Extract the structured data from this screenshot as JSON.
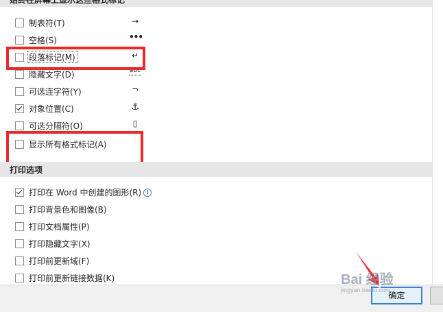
{
  "display_section": {
    "header": "始终在屏幕上显示这些格式标记",
    "items": [
      {
        "label": "制表符(T)",
        "checked": false,
        "symbol": "→",
        "symbol_icon": "tab-arrow-icon"
      },
      {
        "label": "空格(S)",
        "checked": false,
        "symbol": "•••",
        "symbol_icon": "space-dots-icon"
      },
      {
        "label": "段落标记(M)",
        "checked": false,
        "symbol": "↵",
        "symbol_icon": "paragraph-mark-icon"
      },
      {
        "label": "隐藏文字(D)",
        "checked": false,
        "symbol": "abc",
        "symbol_icon": "hidden-text-icon"
      },
      {
        "label": "可选连字符(Y)",
        "checked": false,
        "symbol": "¬",
        "symbol_icon": "optional-hyphen-icon"
      },
      {
        "label": "对象位置(C)",
        "checked": true,
        "symbol": "⚓",
        "symbol_icon": "anchor-icon"
      },
      {
        "label": "可选分隔符(O)",
        "checked": false,
        "symbol": "▯",
        "symbol_icon": "optional-break-icon"
      },
      {
        "label": "显示所有格式标记(A)",
        "checked": false,
        "symbol": "",
        "symbol_icon": ""
      }
    ]
  },
  "print_section": {
    "header": "打印选项",
    "items": [
      {
        "label": "打印在 Word 中创建的图形(R)",
        "checked": true,
        "info_icon": "i"
      },
      {
        "label": "打印背景色和图像(B)",
        "checked": false
      },
      {
        "label": "打印文档属性(P)",
        "checked": false
      },
      {
        "label": "打印隐藏文字(X)",
        "checked": false
      },
      {
        "label": "打印前更新域(F)",
        "checked": false
      },
      {
        "label": "打印前更新链接数据(K)",
        "checked": false
      }
    ]
  },
  "footer": {
    "ok_label": "确定"
  },
  "watermark": {
    "main": "Bai 经验",
    "sub": "jingyan.baidu.com"
  },
  "colors": {
    "highlight_red": "#e8292e",
    "section_header_bg": "#e6e6e6",
    "ok_border": "#3c7fd1"
  }
}
